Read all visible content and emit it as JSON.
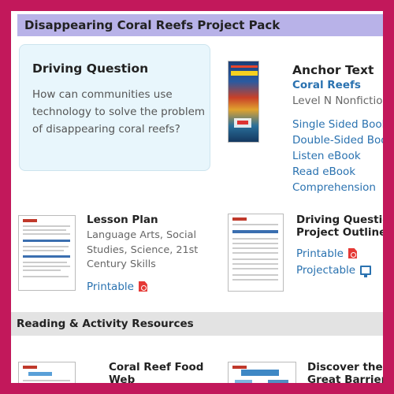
{
  "header": {
    "title": "Disappearing Coral Reefs Project Pack"
  },
  "driving_question": {
    "title": "Driving Question",
    "text": "How can communities use technology to solve the problem of disappearing coral reefs?"
  },
  "anchor": {
    "title": "Anchor Text",
    "book_title": "Coral Reefs",
    "level": "Level N Nonfiction",
    "links": [
      "Single Sided Book",
      "Double-Sided Book",
      "Listen eBook",
      "Read eBook",
      "Comprehension"
    ]
  },
  "lesson_plan": {
    "title": "Lesson Plan",
    "subjects": "Language Arts, Social Studies, Science, 21st Century Skills",
    "printable_label": "Printable"
  },
  "dq_outline": {
    "title_line1": "Driving Question",
    "title_line2": "Project Outline",
    "printable_label": "Printable",
    "projectable_label": "Projectable"
  },
  "reading_section": {
    "title": "Reading & Activity Resources"
  },
  "food_web": {
    "title_line1": "Coral Reef Food",
    "title_line2": "Web"
  },
  "barrier": {
    "title_line1": "Discover the",
    "title_line2": "Great Barrier"
  },
  "icons": {
    "pdf": "pdf-icon",
    "projectable": "projector-icon"
  },
  "colors": {
    "frame": "#c2185b",
    "header": "#b8b2e8",
    "link": "#2a72b0",
    "card": "#e8f6fc"
  }
}
